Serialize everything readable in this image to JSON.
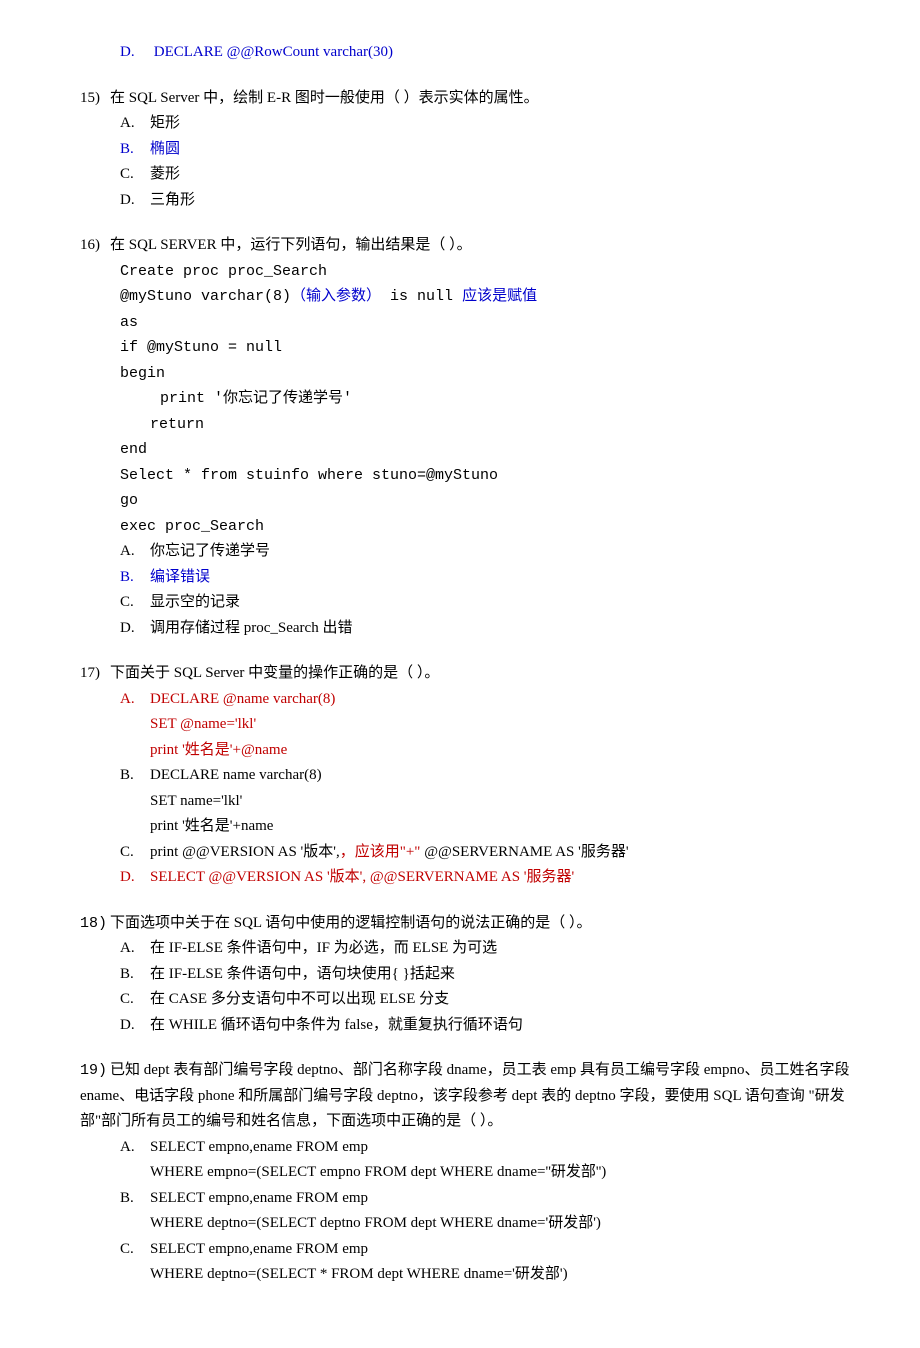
{
  "q14": {
    "optD_label": "D.",
    "optD_text": "DECLARE @@RowCount   varchar(30)"
  },
  "q15": {
    "num": "15)",
    "stem": "在 SQL Server 中，绘制 E-R 图时一般使用（   ）表示实体的属性。",
    "A_label": "A.",
    "A_text": "矩形",
    "B_label": "B.",
    "B_text": "椭圆",
    "C_label": "C.",
    "C_text": "菱形",
    "D_label": "D.",
    "D_text": "三角形"
  },
  "q16": {
    "num": "16)",
    "stem": "在 SQL SERVER 中，运行下列语句，输出结果是（   ）。",
    "code1": "Create proc proc_Search",
    "code2a": "@myStuno varchar(8)",
    "code2b": "（输入参数）",
    "code2c": "  is null",
    "code2d": "   应该是赋值",
    "code3": "as",
    "code4": "if @myStuno = null",
    "code5": "begin",
    "code6": "print '你忘记了传递学号'",
    "code7": "return",
    "code8": "end",
    "code9": "Select * from stuinfo where stuno=@myStuno",
    "code10": "go",
    "code11": "exec proc_Search",
    "A_label": "A.",
    "A_text": "你忘记了传递学号",
    "B_label": "B.",
    "B_text": "编译错误",
    "C_label": "C.",
    "C_text": "显示空的记录",
    "D_label": "D.",
    "D_text": "调用存储过程 proc_Search 出错"
  },
  "q17": {
    "num": "17)",
    "stem": "下面关于 SQL Server 中变量的操作正确的是（   ）。",
    "A_label": "A.",
    "A_l1": "DECLARE @name varchar(8)",
    "A_l2": "SET @name='lkl'",
    "A_l3": "print '姓名是'+@name",
    "B_label": "B.",
    "B_l1": "DECLARE name varchar(8)",
    "B_l2": "SET name='lkl'",
    "B_l3": "print '姓名是'+name",
    "C_label": "C.",
    "C_l1a": "print   @@VERSION AS '版本',",
    "C_l1b": "，应该用\"+\"",
    "C_l1c": " @@SERVERNAME AS '服务器'",
    "D_label": "D.",
    "D_l1": "SELECT @@VERSION AS '版本', @@SERVERNAME AS '服务器'"
  },
  "q18": {
    "num": "18)",
    "stem": "下面选项中关于在 SQL 语句中使用的逻辑控制语句的说法正确的是（   ）。",
    "A_label": "A.",
    "A_text": "在 IF-ELSE 条件语句中，IF 为必选，而 ELSE 为可选",
    "B_label": "B.",
    "B_text": "在 IF-ELSE 条件语句中，语句块使用{   }括起来",
    "C_label": "C.",
    "C_text": "在 CASE 多分支语句中不可以出现 ELSE 分支",
    "D_label": "D.",
    "D_text": "在 WHILE 循环语句中条件为 false，就重复执行循环语句"
  },
  "q19": {
    "num": "19)",
    "stem": "已知 dept 表有部门编号字段 deptno、部门名称字段 dname，员工表 emp 具有员工编号字段 empno、员工姓名字段 ename、电话字段 phone 和所属部门编号字段 deptno，该字段参考 dept 表的 deptno 字段，要使用 SQL 语句查询 \"研发部\"部门所有员工的编号和姓名信息，下面选项中正确的是（   ）。",
    "A_label": "A.",
    "A_l1": "SELECT empno,ename FROM emp",
    "A_l2": "WHERE empno=(SELECT empno FROM dept WHERE dname=''研发部'')",
    "B_label": "B.",
    "B_l1": "SELECT empno,ename FROM emp",
    "B_l2": "WHERE deptno=(SELECT deptno FROM dept WHERE dname='研发部')",
    "C_label": "C.",
    "C_l1": "SELECT empno,ename FROM emp",
    "C_l2": "WHERE deptno=(SELECT * FROM dept WHERE dname='研发部')"
  }
}
